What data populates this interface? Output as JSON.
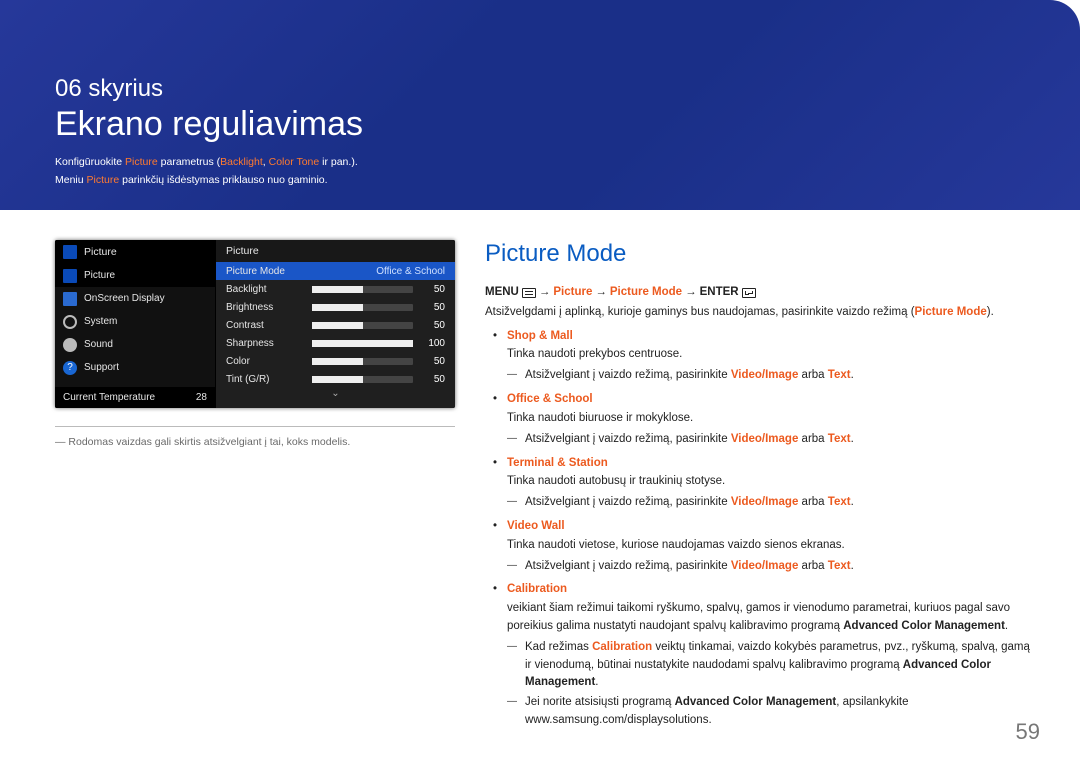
{
  "header": {
    "chapter_num": "06 skyrius",
    "chapter_title": "Ekrano reguliavimas",
    "note1_pre": "Konfigūruokite ",
    "note1_picture": "Picture",
    "note1_mid": " parametrus (",
    "note1_backlight": "Backlight",
    "note1_sep": ", ",
    "note1_colortone": "Color Tone",
    "note1_end": " ir pan.).",
    "note2_pre": "Meniu ",
    "note2_picture": "Picture",
    "note2_end": " parinkčių išdėstymas priklauso nuo gaminio."
  },
  "osd": {
    "left_head": "Picture",
    "items": [
      {
        "label": "Picture"
      },
      {
        "label": "OnScreen Display"
      },
      {
        "label": "System"
      },
      {
        "label": "Sound"
      },
      {
        "label": "Support"
      }
    ],
    "foot_label": "Current Temperature",
    "foot_value": "28",
    "right_head": "Picture",
    "mode_row": {
      "label": "Picture Mode",
      "value": "Office & School"
    },
    "sliders": [
      {
        "label": "Backlight",
        "value": 50,
        "max": 100
      },
      {
        "label": "Brightness",
        "value": 50,
        "max": 100
      },
      {
        "label": "Contrast",
        "value": 50,
        "max": 100
      },
      {
        "label": "Sharpness",
        "value": 100,
        "max": 100
      },
      {
        "label": "Color",
        "value": 50,
        "max": 100
      },
      {
        "label": "Tint (G/R)",
        "value": 50,
        "max": 100
      }
    ]
  },
  "footnote": "Rodomas vaizdas gali skirtis atsižvelgiant į tai, koks modelis.",
  "section_title": "Picture Mode",
  "bc": {
    "menu": "MENU",
    "arrow": "→",
    "picture": "Picture",
    "picture_mode": "Picture Mode",
    "enter": "ENTER"
  },
  "intro_pre": "Atsižvelgdami į aplinką, kurioje gaminys bus naudojamas, pasirinkite vaizdo režimą (",
  "intro_mode": "Picture Mode",
  "intro_post": ").",
  "modes": [
    {
      "name": "Shop & Mall",
      "desc": "Tinka naudoti prekybos centruose.",
      "sub": [
        {
          "pre": "Atsižvelgiant į vaizdo režimą, pasirinkite ",
          "a": "Video/Image",
          "mid": " arba ",
          "b": "Text",
          "post": "."
        }
      ]
    },
    {
      "name": "Office & School",
      "desc": "Tinka naudoti biuruose ir mokyklose.",
      "sub": [
        {
          "pre": "Atsižvelgiant į vaizdo režimą, pasirinkite ",
          "a": "Video/Image",
          "mid": " arba ",
          "b": "Text",
          "post": "."
        }
      ]
    },
    {
      "name": "Terminal & Station",
      "desc": "Tinka naudoti autobusų ir traukinių stotyse.",
      "sub": [
        {
          "pre": "Atsižvelgiant į vaizdo režimą, pasirinkite ",
          "a": "Video/Image",
          "mid": " arba ",
          "b": "Text",
          "post": "."
        }
      ]
    },
    {
      "name": "Video Wall",
      "desc": "Tinka naudoti vietose, kuriose naudojamas vaizdo sienos ekranas.",
      "sub": [
        {
          "pre": "Atsižvelgiant į vaizdo režimą, pasirinkite ",
          "a": "Video/Image",
          "mid": " arba ",
          "b": "Text",
          "post": "."
        }
      ]
    },
    {
      "name": "Calibration",
      "desc_pre": "veikiant šiam režimui taikomi ryškumo, spalvų, gamos ir vienodumo parametrai, kuriuos pagal savo poreikius galima nustatyti naudojant spalvų kalibravimo programą ",
      "desc_bold": "Advanced Color Management",
      "desc_post": ".",
      "sub": [
        {
          "pre": "Kad režimas ",
          "a": "Calibration",
          "mid": " veiktų tinkamai, vaizdo kokybės parametrus, pvz., ryškumą, spalvą, gamą ir vienodumą, būtinai nustatykite naudodami spalvų kalibravimo programą ",
          "b_bold": "Advanced Color Management",
          "post": "."
        },
        {
          "pre": "Jei norite atsisiųsti programą ",
          "a_bold": "Advanced Color Management",
          "mid": ", apsilankykite www.samsung.com/displaysolutions.",
          "post": ""
        }
      ]
    }
  ],
  "page_number": "59"
}
